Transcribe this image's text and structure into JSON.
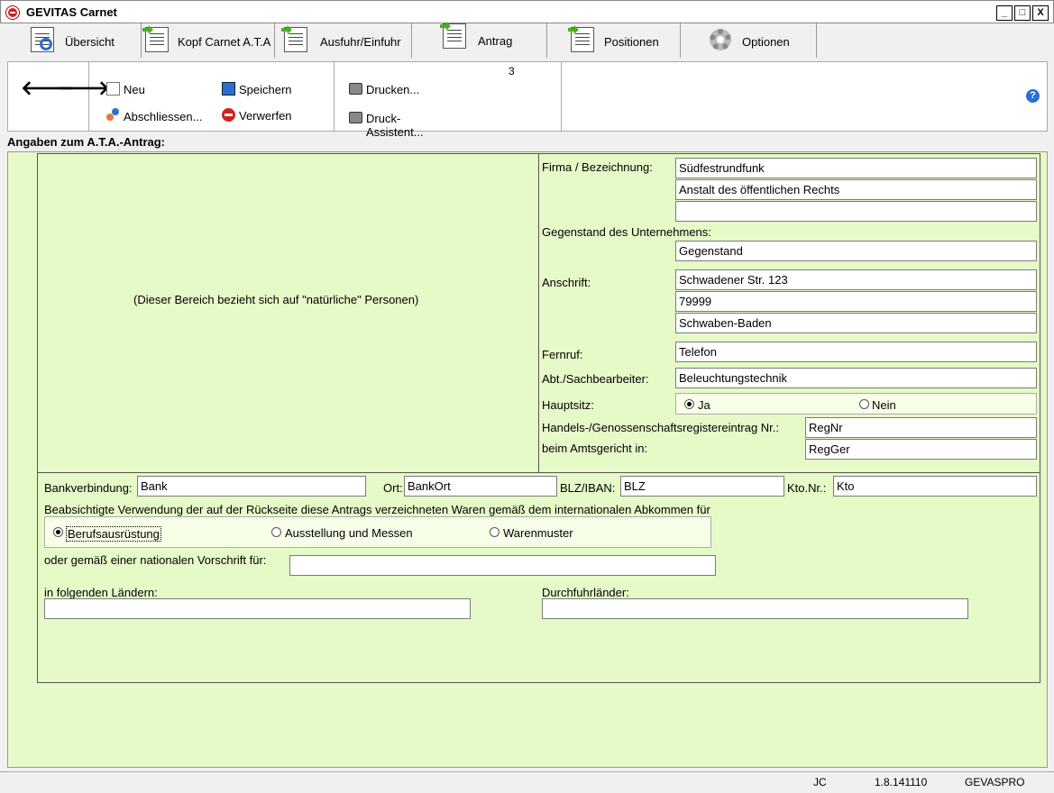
{
  "window": {
    "title": "GEVITAS Carnet",
    "buttons": {
      "minimize": "_",
      "maximize": "□",
      "close": "X"
    }
  },
  "tabs": [
    {
      "label": "Übersicht",
      "icon": "overview-icon"
    },
    {
      "label": "Kopf Carnet A.T.A",
      "icon": "document-icon"
    },
    {
      "label": "Ausfuhr/Einfuhr",
      "icon": "document-icon"
    },
    {
      "label": "Antrag",
      "icon": "document-icon"
    },
    {
      "label": "Positionen",
      "icon": "document-icon"
    },
    {
      "label": "Optionen",
      "icon": "gear-icon"
    }
  ],
  "toolbar": {
    "new_label": "Neu",
    "save_label": "Speichern",
    "finish_label": "Abschliessen...",
    "discard_label": "Verwerfen",
    "print_label": "Drucken...",
    "print_wizard_label": "Druck-Assistent...",
    "print_badge": "3"
  },
  "section_title": "Angaben zum A.T.A.-Antrag:",
  "natural_persons_note": "(Dieser Bereich bezieht sich auf \"natürliche\" Personen)",
  "company": {
    "firma_label": "Firma / Bezeichnung:",
    "firma_line1": "Südfestrundfunk",
    "firma_line2": "Anstalt des öffentlichen Rechts",
    "firma_line3": "",
    "gegenstand_label": "Gegenstand des Unternehmens:",
    "gegenstand_value": "Gegenstand",
    "anschrift_label": "Anschrift:",
    "street": "Schwadener Str. 123",
    "zip": "79999",
    "city": "Schwaben-Baden",
    "fernruf_label": "Fernruf:",
    "fernruf_value": "Telefon",
    "abt_label": "Abt./Sachbearbeiter:",
    "abt_value": "Beleuchtungstechnik",
    "hauptsitz_label": "Hauptsitz:",
    "hauptsitz_ja": "Ja",
    "hauptsitz_nein": "Nein",
    "register_label": "Handels-/Genossenschaftsregistereintrag Nr.:",
    "register_value": "RegNr",
    "amtsgericht_label": "beim Amtsgericht in:",
    "amtsgericht_value": "RegGer"
  },
  "bank": {
    "bank_label": "Bankverbindung:",
    "bank_value": "Bank",
    "ort_label": "Ort:",
    "ort_value": "BankOrt",
    "blz_label": "BLZ/IBAN:",
    "blz_value": "BLZ",
    "kto_label": "Kto.Nr.:",
    "kto_value": "Kto"
  },
  "usage": {
    "intro": "Beabsichtigte Verwendung der auf der Rückseite diese Antrags verzeichneten Waren gemäß dem internationalen Abkommen für",
    "opt1": "Berufsausrüstung",
    "opt2": "Ausstellung und Messen",
    "opt3": "Warenmuster",
    "national_label": "oder gemäß einer nationalen Vorschrift für:",
    "national_value": "",
    "countries_label": "in folgenden Ländern:",
    "countries_value": "",
    "transit_label": "Durchfuhrländer:",
    "transit_value": ""
  },
  "status": {
    "user": "JC",
    "version": "1.8.141110",
    "db": "GEVASPRO"
  },
  "colors": {
    "form_bg": "#e6fac8",
    "accent_red": "#d21f1f",
    "help_blue": "#2a6fd1"
  }
}
